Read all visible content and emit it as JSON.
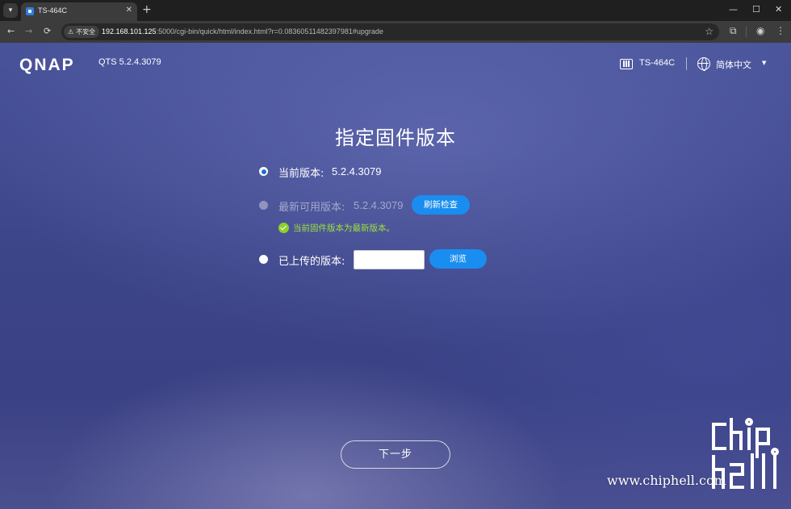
{
  "browser": {
    "tab_title": "TS-464C",
    "tab_close": "✕",
    "new_tab": "+",
    "window_controls": {
      "minimize": "—",
      "maximize": "☐",
      "close": "✕"
    },
    "nav": {
      "back": "←",
      "forward": "→",
      "reload": "⟳"
    },
    "security_label": "不安全",
    "url_host": "192.168.101.125",
    "url_rest": ":5000/cgi-bin/quick/html/index.html?r=0.08360511482397981#upgrade"
  },
  "header": {
    "logo": "QNAP",
    "os_version": "QTS 5.2.4.3079",
    "device_name": "TS-464C",
    "language": "简体中文",
    "language_caret": "▼"
  },
  "main": {
    "title": "指定固件版本",
    "options": [
      {
        "label": "当前版本:",
        "value": "5.2.4.3079",
        "state": "checked"
      },
      {
        "label": "最新可用版本:",
        "value": "5.2.4.3079",
        "state": "disabled",
        "button": "刷新检查"
      },
      {
        "label": "已上传的版本:",
        "value": "",
        "state": "unchecked",
        "button": "浏览"
      }
    ],
    "status_message": "当前固件版本为最新版本。",
    "next_button": "下一步"
  },
  "watermark": {
    "text": "www.chiphell.com"
  },
  "colors": {
    "accent": "#1a8df0",
    "success": "#8dd02d",
    "background_top": "#49539a",
    "background_bottom": "#3a4184"
  }
}
